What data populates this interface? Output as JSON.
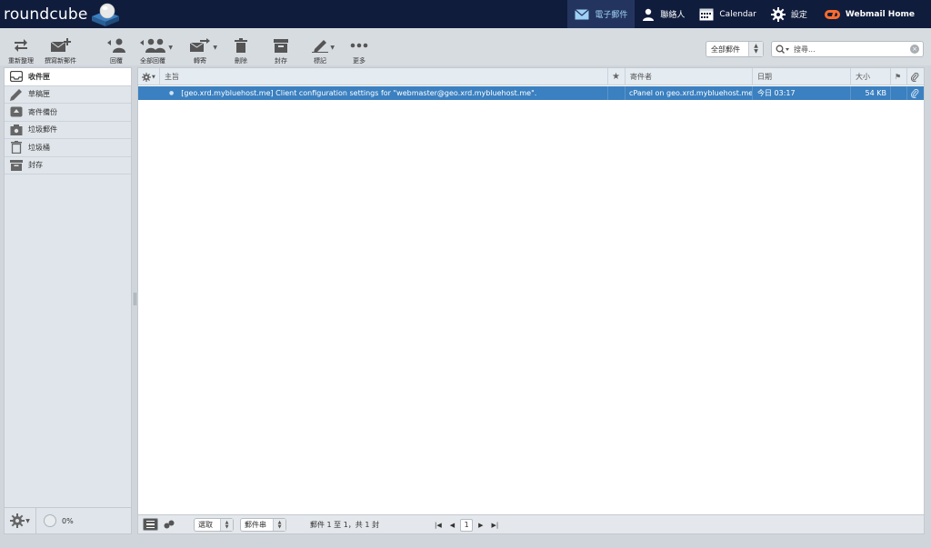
{
  "app": {
    "name": "roundcube"
  },
  "topnav": [
    {
      "label": "電子郵件",
      "icon": "mail-icon",
      "active": true
    },
    {
      "label": "聯絡人",
      "icon": "person-icon",
      "active": false
    },
    {
      "label": "Calendar",
      "icon": "calendar-icon",
      "active": false
    },
    {
      "label": "設定",
      "icon": "gear-icon",
      "active": false
    },
    {
      "label": "Webmail Home",
      "icon": "cpanel-icon",
      "active": false
    }
  ],
  "toolbar": {
    "refresh": "重新整理",
    "compose": "撰寫新郵件",
    "reply": "回覆",
    "reply_all": "全部回覆",
    "forward": "轉寄",
    "delete": "刪除",
    "archive": "封存",
    "mark": "標記",
    "more": "更多",
    "filter_value": "全部郵件",
    "search_placeholder": "搜尋..."
  },
  "folders": [
    {
      "label": "收件匣",
      "icon": "inbox-icon",
      "active": true
    },
    {
      "label": "草稿匣",
      "icon": "pencil-icon",
      "active": false
    },
    {
      "label": "寄件備份",
      "icon": "sent-icon",
      "active": false
    },
    {
      "label": "垃圾郵件",
      "icon": "junk-icon",
      "active": false
    },
    {
      "label": "垃圾桶",
      "icon": "trash-icon",
      "active": false
    },
    {
      "label": "封存",
      "icon": "archive-icon",
      "active": false
    }
  ],
  "quota": "0%",
  "columns": {
    "subject": "主旨",
    "from": "寄件者",
    "date": "日期",
    "size": "大小"
  },
  "messages": [
    {
      "subject": "[geo.xrd.mybluehost.me] Client configuration settings for \"webmaster@geo.xrd.mybluehost.me\".",
      "from": "cPanel on geo.xrd.mybluehost.me",
      "date": "今日 03:17",
      "size": "54 KB"
    }
  ],
  "footer": {
    "select_label": "選取",
    "threads_label": "郵件串",
    "count_text": "郵件 1 至 1，共 1 封",
    "page": "1"
  },
  "colors": {
    "topbar": "#101c3c",
    "selected_row": "#3b80c0",
    "active_nav_text": "#9fd0f5"
  }
}
